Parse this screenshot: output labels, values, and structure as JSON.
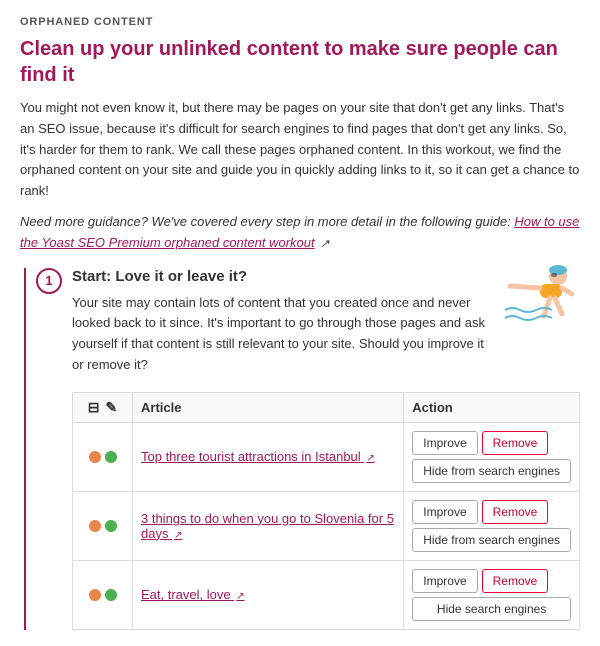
{
  "section": {
    "label": "ORPHANED CONTENT",
    "title": "Clean up your unlinked content to make sure people can find it",
    "intro": "You might not even know it, but there may be pages on your site that don't get any links. That's an SEO issue, because it's difficult for search engines to find pages that don't get any links. So, it's harder for them to rank. We call these pages orphaned content. In this workout, we find the orphaned content on your site and guide you in quickly adding links to it, so it can get a chance to rank!",
    "guidance_prefix": "Need more guidance? We've covered every step in more detail in the following guide: ",
    "guidance_link_text": "How to use the Yoast SEO Premium orphaned content workout",
    "guidance_link_icon": "↗"
  },
  "step": {
    "number": "1",
    "title": "Start: Love it or leave it?",
    "description": "Your site may contain lots of content that you created once and never looked back to it since. It's important to go through those pages and ask yourself if that content is still relevant to your site. Should you improve it or remove it?",
    "table": {
      "columns": [
        "icons",
        "pencil",
        "Article",
        "Action"
      ],
      "rows": [
        {
          "article_link": "Top three tourist attractions in Istanbul",
          "article_ext": "↗",
          "btn_improve": "Improve",
          "btn_remove": "Remove",
          "btn_hide": "Hide from search engines"
        },
        {
          "article_link": "3 things to do when you go to Slovenia for 5 days",
          "article_ext": "↗",
          "btn_improve": "Improve",
          "btn_remove": "Remove",
          "btn_hide": "Hide from search engines"
        },
        {
          "article_link": "Eat, travel, love",
          "article_ext": "↗",
          "btn_improve": "Improve",
          "btn_remove": "Remove",
          "btn_hide": "Hide search engines"
        }
      ]
    }
  }
}
